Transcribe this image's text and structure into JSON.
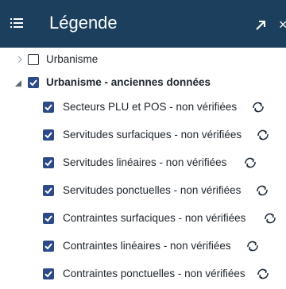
{
  "header": {
    "title": "Légende",
    "background": "#1b3f5c",
    "menu_icon": "hamburger-icon",
    "expand_icon": "arrow-up-right-icon",
    "close_icon": "close-icon"
  },
  "tree": {
    "groups": [
      {
        "label": "Urbanisme",
        "checked": false,
        "expanded": false
      },
      {
        "label": "Urbanisme - anciennes données",
        "checked": true,
        "expanded": true,
        "children": [
          {
            "label": "Secteurs PLU et POS - non vérifiées",
            "checked": true,
            "icon": "refresh-icon"
          },
          {
            "label": "Servitudes surfaciques - non vérifiées",
            "checked": true,
            "icon": "refresh-icon"
          },
          {
            "label": "Servitudes linéaires - non vérifiées",
            "checked": true,
            "icon": "refresh-icon"
          },
          {
            "label": "Servitudes ponctuelles - non vérifiées",
            "checked": true,
            "icon": "refresh-icon"
          },
          {
            "label": "Contraintes surfaciques - non vérifiées",
            "checked": true,
            "icon": "refresh-icon"
          },
          {
            "label": "Contraintes linéaires - non vérifiées",
            "checked": true,
            "icon": "refresh-icon"
          },
          {
            "label": "Contraintes ponctuelles - non vérifiées",
            "checked": true,
            "icon": "refresh-icon"
          }
        ]
      }
    ]
  },
  "colors": {
    "checkbox_checked": "#2c4a88",
    "text": "#20272f"
  }
}
